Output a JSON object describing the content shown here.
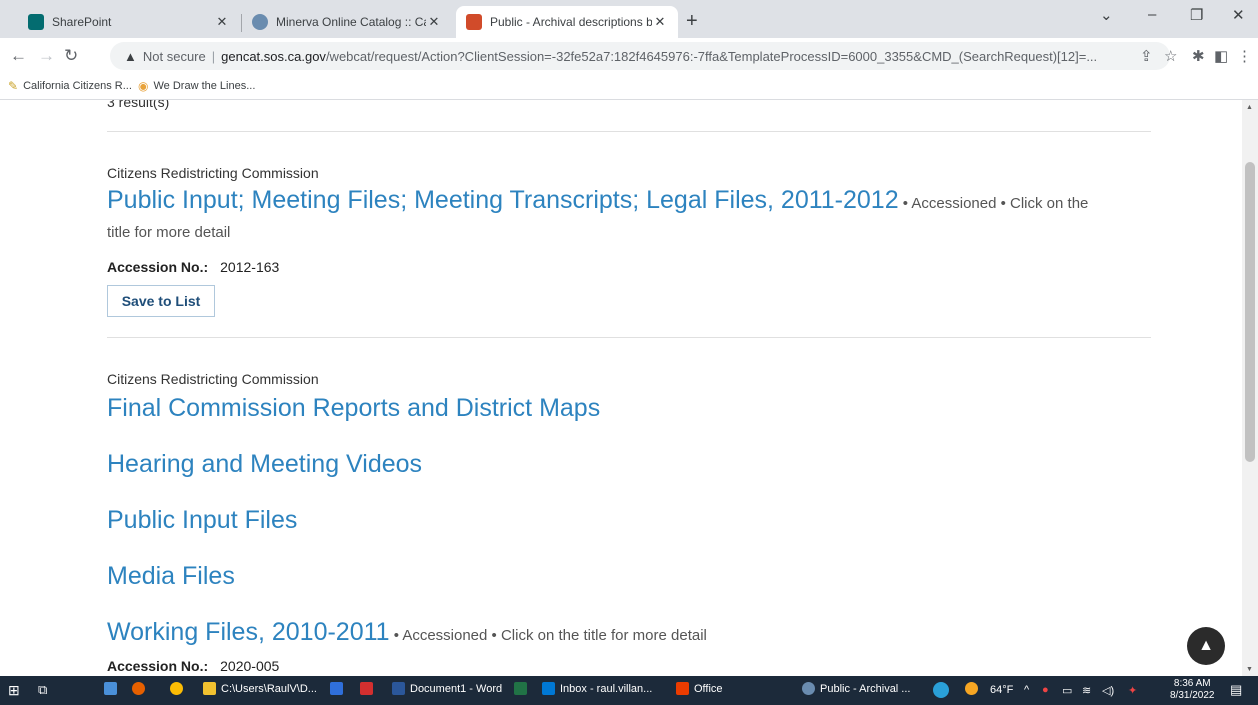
{
  "browser": {
    "tabs": [
      {
        "label": "SharePoint",
        "color": "#036c70"
      },
      {
        "label": "Minerva Online Catalog :: Califor",
        "color": "#6a8caf"
      },
      {
        "label": "Public - Archival descriptions brc",
        "color": "#d14b2a",
        "active": true
      }
    ],
    "new_tab": "+",
    "window_controls": [
      "⌄",
      "–",
      "❐",
      "✕"
    ],
    "address": {
      "security_label": "Not secure",
      "host": "gencat.sos.ca.gov",
      "path": "/webcat/request/Action?ClientSession=-32fe52a7:182f4645976:-7ffa&TemplateProcessID=6000_3355&CMD_(SearchRequest)[12]=..."
    },
    "bookmarks": [
      {
        "label": "California Citizens R...",
        "icon": "pen-icon"
      },
      {
        "label": "We Draw the Lines...",
        "icon": "rainbow-icon"
      }
    ]
  },
  "page": {
    "results_count": "3 result(s)",
    "results": [
      {
        "agency": "Citizens Redistricting Commission",
        "title": "Public Input; Meeting Files; Meeting Transcripts; Legal Files,  2011-2012",
        "meta_inline": " • Accessioned • Click on the",
        "meta_wrap": "title for more detail",
        "accession_label": "Accession No.:",
        "accession_value": "2012-163",
        "save_label": "Save to List"
      },
      {
        "agency": "Citizens Redistricting Commission",
        "titles": [
          "Final Commission Reports and District Maps",
          "Hearing and Meeting Videos",
          "Public Input Files",
          "Media Files"
        ],
        "last_title": "Working Files,  2010-2011",
        "last_meta": " • Accessioned • Click on the title for more detail",
        "accession_label": "Accession No.:",
        "accession_value": "2020-005"
      }
    ]
  },
  "taskbar": {
    "items": [
      {
        "label": "C:\\Users\\RaulV\\D...",
        "color": "#f2c230"
      },
      {
        "label": "Document1 - Word",
        "color": "#2b579a"
      },
      {
        "label": "Inbox - raul.villan...",
        "color": "#0078d4"
      },
      {
        "label": "Office",
        "color": "#eb3c00"
      },
      {
        "label": "Public - Archival ...",
        "color": "#6a8caf"
      }
    ],
    "weather": "64°F",
    "time": "8:36 AM",
    "date": "8/31/2022"
  }
}
